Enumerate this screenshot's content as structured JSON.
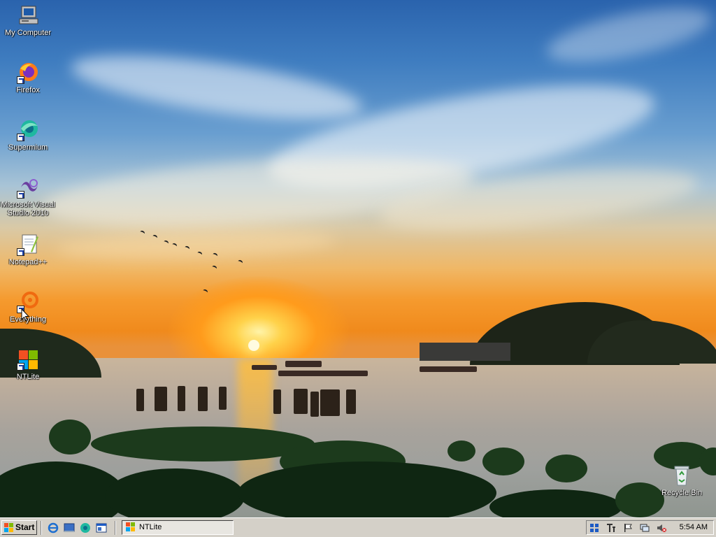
{
  "desktop": {
    "icons": [
      {
        "label": "My Computer",
        "icon": "my-computer-icon"
      },
      {
        "label": "Firefox",
        "icon": "firefox-icon"
      },
      {
        "label": "Supermium",
        "icon": "supermium-icon"
      },
      {
        "label": "Microsoft Visual Studio 2010",
        "icon": "visual-studio-icon"
      },
      {
        "label": "Notepad++",
        "icon": "notepadpp-icon"
      },
      {
        "label": "Everything",
        "icon": "everything-icon"
      },
      {
        "label": "NTLite",
        "icon": "ntlite-icon"
      }
    ],
    "recycle_bin": {
      "label": "Recycle Bin",
      "icon": "recycle-bin-icon"
    }
  },
  "taskbar": {
    "start_label": "Start",
    "quick_launch": [
      "internet-explorer-icon",
      "show-desktop-icon",
      "supermium-icon",
      "window-switch-icon"
    ],
    "tasks": [
      {
        "label": "NTLite",
        "icon": "ntlite-icon",
        "active": true
      }
    ],
    "tray_icons": [
      "windows-logo-icon",
      "text-tool-icon",
      "flag-icon",
      "network-icon",
      "volume-muted-icon"
    ],
    "clock": "5:54 AM"
  },
  "colors": {
    "taskbar": "#d4d0c8",
    "sky_top": "#2a63ad",
    "sunset": "#f08a1c"
  }
}
